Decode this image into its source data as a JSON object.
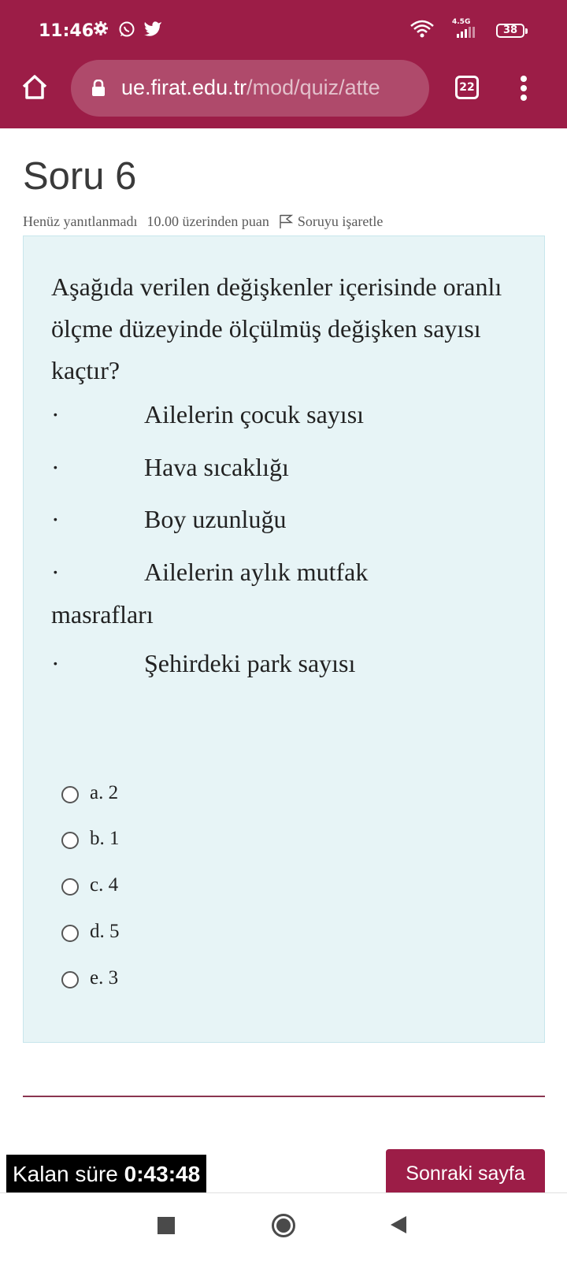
{
  "status_bar": {
    "time": "11:46",
    "network": "4.5G",
    "battery": "38",
    "icons": [
      "settings-gear-icon",
      "whatsapp-icon",
      "twitter-icon",
      "wifi-icon",
      "signal-icon"
    ]
  },
  "browser": {
    "url_host": "ue.firat.edu.tr",
    "url_path": "/mod/quiz/atte",
    "tab_count": "22"
  },
  "question": {
    "heading": "Soru 6",
    "status": "Henüz yanıtlanmadı",
    "points": "10.00 üzerinden puan",
    "flag_label": "Soruyu işaretle",
    "text": "Aşağıda verilen değişkenler içerisinde oranlı ölçme düzeyinde ölçülmüş değişken sayısı kaçtır?",
    "items": [
      {
        "bullet": "·",
        "text": "Ailelerin çocuk sayısı"
      },
      {
        "bullet": "·",
        "text": "Hava sıcaklığı"
      },
      {
        "bullet": "·",
        "text": "Boy uzunluğu"
      },
      {
        "bullet": "·",
        "text": "Ailelerin aylık mutfak",
        "continuation": "masrafları"
      },
      {
        "bullet": "·",
        "text": "Şehirdeki park sayısı"
      }
    ],
    "options": [
      "a. 2",
      "b. 1",
      "c. 4",
      "d. 5",
      "e. 3"
    ]
  },
  "footer": {
    "timer_label": "Kalan süre",
    "timer_value": "0:43:48",
    "next_button": "Sonraki sayfa"
  },
  "colors": {
    "brand": "#9c1d47",
    "question_bg": "#e7f4f6"
  }
}
